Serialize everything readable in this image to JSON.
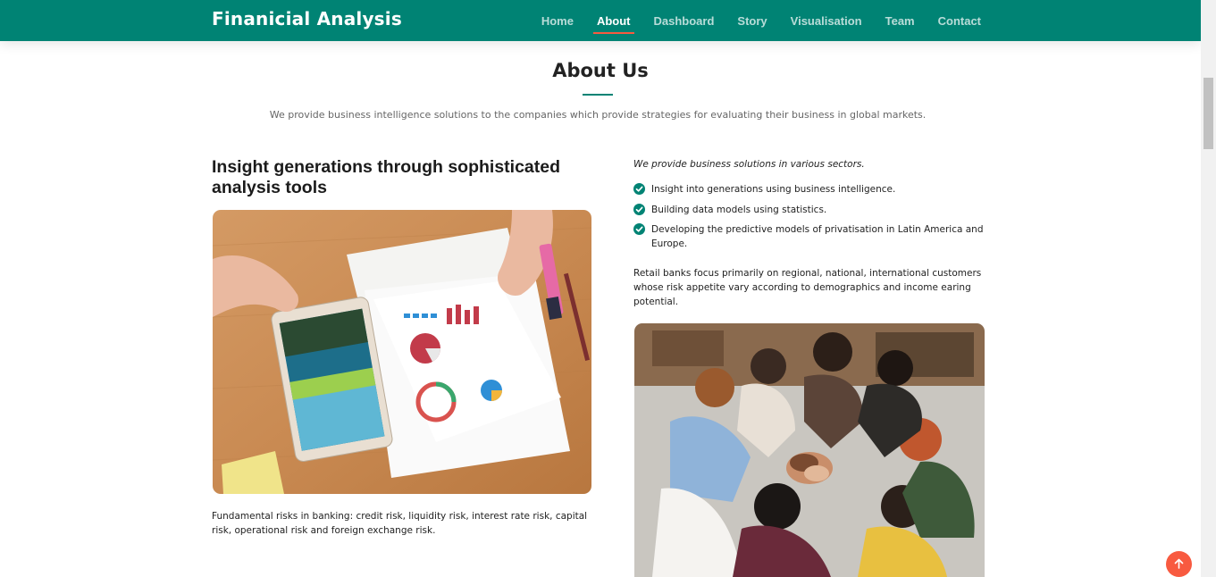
{
  "header": {
    "brand": "Finanicial Analysis",
    "nav": [
      {
        "label": "Home",
        "active": false
      },
      {
        "label": "About",
        "active": true
      },
      {
        "label": "Dashboard",
        "active": false
      },
      {
        "label": "Story",
        "active": false
      },
      {
        "label": "Visualisation",
        "active": false
      },
      {
        "label": "Team",
        "active": false
      },
      {
        "label": "Contact",
        "active": false
      }
    ]
  },
  "about": {
    "title": "About Us",
    "subtitle": "We provide business intelligence solutions to the companies which provide strategies for evaluating their business in global markets.",
    "left": {
      "heading": "Insight generations through sophisticated analysis tools",
      "image_icon": "tablet-with-charts-photo",
      "caption": "Fundamental risks in banking: credit risk, liquidity risk, interest rate risk, capital risk, operational risk and foreign exchange risk."
    },
    "right": {
      "intro": "We provide business solutions in various sectors.",
      "list": [
        "Insight into generations using business intelligence.",
        "Building data models using statistics.",
        "Developing the predictive models of privatisation in Latin America and Europe."
      ],
      "paragraph": "Retail banks focus primarily on regional, national, international customers whose risk appetite vary according to demographics and income earing potential.",
      "image_icon": "team-hands-together-photo"
    }
  },
  "colors": {
    "brand": "#008374",
    "accent": "#f85a40"
  },
  "back_to_top_icon": "arrow-up-icon"
}
